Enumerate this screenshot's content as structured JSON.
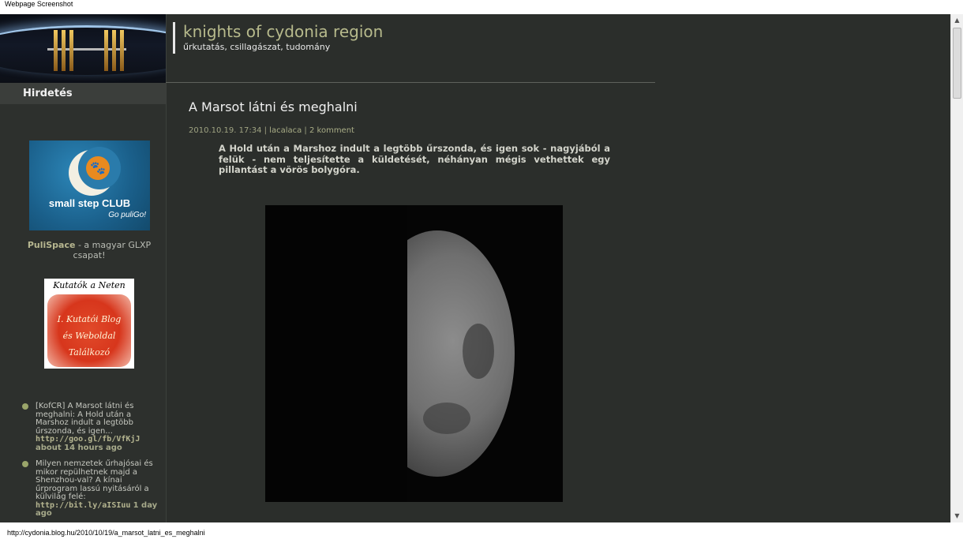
{
  "caption": "Webpage Screenshot",
  "site": {
    "title": "knights of cydonia region",
    "subtitle": "űrkutatás, csillagászat, tudomány"
  },
  "sidebar": {
    "title": "Hirdetés",
    "ad": {
      "line1": "small step CLUB",
      "line2": "Go puliGo!"
    },
    "pulispace": {
      "name": "PuliSpace",
      "text": " - a magyar GLXP csapat!"
    },
    "kutatok": {
      "head": "Kutatók a Neten",
      "lines": [
        "I. Kutatói Blog",
        "és Weboldal",
        "Találkozó"
      ]
    },
    "tweets": [
      {
        "text": "[KofCR] A Marsot látni és meghalni: A Hold után a Marshoz indult a legtöbb űrszonda, és igen...",
        "link": "http://goo.gl/fb/VfKjJ",
        "ago": "about 14 hours ago"
      },
      {
        "text": "Milyen nemzetek űrhajósai és mikor repülhetnek majd a Shenzhou-val? A kínai űrprogram lassú nyitásáról a külvilág felé:",
        "link": "http://bit.ly/aISIuu",
        "ago": "1 day ago"
      }
    ]
  },
  "post": {
    "title": "A Marsot látni és meghalni",
    "date": "2010.10.19. 17:34",
    "sep": " | ",
    "author": "lacalaca",
    "comments": "2 komment",
    "lead": "A Hold után a Marshoz indult a legtöbb űrszonda, és igen sok - nagyjából a felük - nem teljesítette a küldetését, néhányan mégis vethettek egy pillantást a vörös bolygóra."
  },
  "status_url": "http://cydonia.blog.hu/2010/10/19/a_marsot_latni_es_meghalni",
  "scrollbar": {
    "up": "▲",
    "down": "▼"
  }
}
